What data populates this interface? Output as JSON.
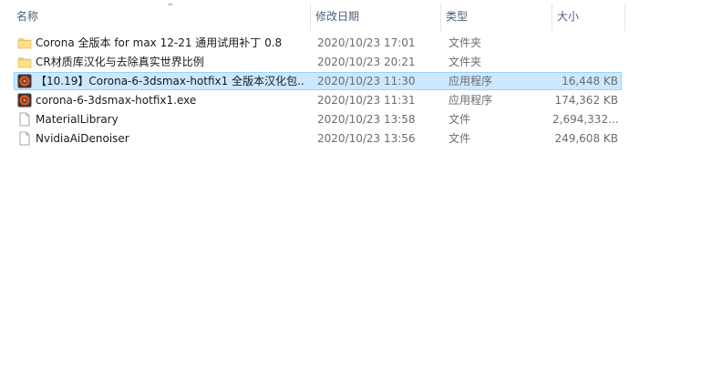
{
  "columns": {
    "name": "名称",
    "date": "修改日期",
    "type": "类型",
    "size": "大小"
  },
  "files": [
    {
      "name": "Corona 全版本 for max 12-21 通用试用补丁 0.8",
      "date": "2020/10/23 17:01",
      "type": "文件夹",
      "size": "",
      "icon": "folder-icon",
      "selected": false
    },
    {
      "name": "CR材质库汉化与去除真实世界比例",
      "date": "2020/10/23 20:21",
      "type": "文件夹",
      "size": "",
      "icon": "folder-icon",
      "selected": false
    },
    {
      "name": "【10.19】Corona-6-3dsmax-hotfix1 全版本汉化包....",
      "date": "2020/10/23 11:30",
      "type": "应用程序",
      "size": "16,448 KB",
      "icon": "corona-app-icon",
      "selected": true
    },
    {
      "name": "corona-6-3dsmax-hotfix1.exe",
      "date": "2020/10/23 11:31",
      "type": "应用程序",
      "size": "174,362 KB",
      "icon": "corona-app-icon",
      "selected": false
    },
    {
      "name": "MaterialLibrary",
      "date": "2020/10/23 13:58",
      "type": "文件",
      "size": "2,694,332...",
      "icon": "file-icon",
      "selected": false
    },
    {
      "name": "NvidiaAiDenoiser",
      "date": "2020/10/23 13:56",
      "type": "文件",
      "size": "249,608 KB",
      "icon": "file-icon",
      "selected": false
    }
  ],
  "colors": {
    "selection_bg": "#cce8ff",
    "selection_border": "#99d1ff",
    "header_text": "#4c607a",
    "folder": "#ffd767",
    "app_orange": "#e8531f"
  }
}
